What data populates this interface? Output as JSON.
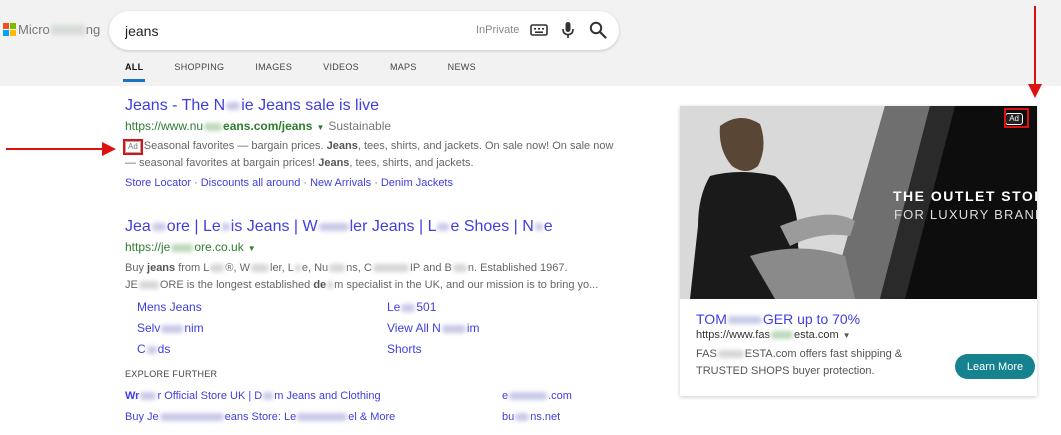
{
  "header": {
    "logo_left": "Micro",
    "logo_right": "ng",
    "search_value": "jeans",
    "inprivate": "InPrivate"
  },
  "tabs": [
    "ALL",
    "SHOPPING",
    "IMAGES",
    "VIDEOS",
    "MAPS",
    "NEWS"
  ],
  "result1": {
    "title_a": "Jeans - The N",
    "title_b": "ie Jeans sale is live",
    "url_a": "https://www.nu",
    "url_b": "eans.com/",
    "url_c": "jeans",
    "url_extra": "Sustainable",
    "ad_label": "Ad",
    "desc1_a": "Seasonal favorites — bargain prices. ",
    "desc1_b": "Jeans",
    "desc1_c": ", tees, shirts, and jackets. On sale now! On sale now",
    "desc2_a": "— seasonal favorites at bargain prices! ",
    "desc2_b": "Jeans",
    "desc2_c": ", tees, shirts, and jackets.",
    "sitelinks": [
      "Store Locator",
      "Discounts all around",
      "New Arrivals",
      "Denim Jackets"
    ],
    "sitelink_sep": "·"
  },
  "result2": {
    "title_a": "Jea",
    "title_b": "ore | Le",
    "title_c": "is Jeans | W",
    "title_d": "ler Jeans | L",
    "title_e": "e Shoes | N",
    "title_f": "e",
    "url_a": "https://je",
    "url_b": "ore.co.uk",
    "desc1_a": "Buy ",
    "desc1_b": "jeans",
    "desc1_c": " from L",
    "desc1_d": "®, W",
    "desc1_e": "ler, L",
    "desc1_f": "e, Nu",
    "desc1_g": "ns, C",
    "desc1_h": "IP and B",
    "desc1_i": "n. Established 1967.",
    "desc2_a": "JE",
    "desc2_b": "ORE is the longest established ",
    "desc2_c": "de",
    "desc2_d": "m specialist in the UK, and our mission is to bring yo..."
  },
  "sublinks": {
    "mens_jeans": "Mens Jeans",
    "le_a": "Le",
    "le_b": "501",
    "selv_a": "Selv",
    "selv_b": "nim",
    "view_all_a": "View All N",
    "view_all_b": "im",
    "co_a": "C",
    "co_b": "ds",
    "shorts": "Shorts"
  },
  "explore": {
    "heading": "EXPLORE FURTHER",
    "link1_a": "Wr",
    "link1_b": "r Official Store UK | D",
    "link1_c": "m Jeans and Clothing",
    "link2_a": "Buy Je",
    "link2_b": "eans Store: Le",
    "link2_c": "el & More",
    "link3_a": "e",
    "link3_b": ".com",
    "link4_a": "bu",
    "link4_b": "ns.net"
  },
  "ad_card": {
    "badge": "Ad",
    "headline": "THE OUTLET STORE",
    "subline": "FOR LUXURY BRANDS",
    "title_a": "TOM",
    "title_b": "GER up to 70%",
    "url_a": "https://www.fas",
    "url_b": "esta.com",
    "desc_a": "FAS",
    "desc_b": "ESTA.com offers fast shipping & TRUSTED SHOPS buyer protection.",
    "cta": "Learn More"
  },
  "colors": {
    "link": "#3e3ee0",
    "url": "#2d7d2d",
    "annotation": "#dd1111",
    "cta": "#16818f",
    "tab_underline": "#1a73c8"
  },
  "icons": [
    "microsoft-logo-icon",
    "keyboard-icon",
    "microphone-icon",
    "search-icon",
    "caret-down-icon"
  ]
}
